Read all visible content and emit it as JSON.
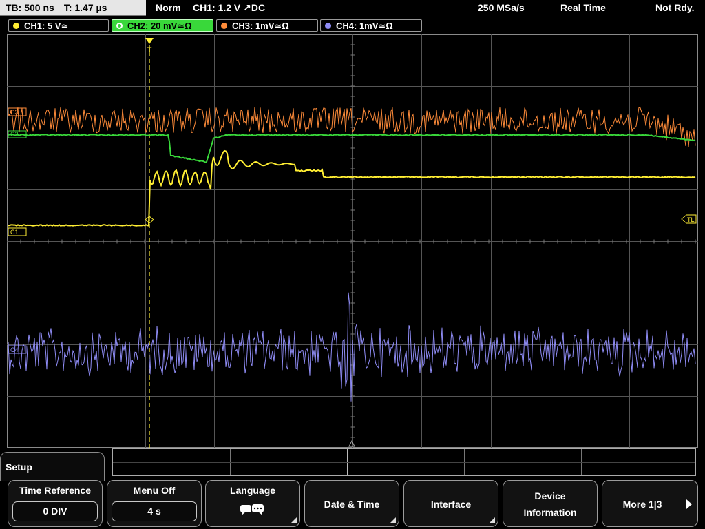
{
  "status": {
    "timebase": "TB: 500 ns",
    "trigger_time": "T: 1.47 µs",
    "mode": "Norm",
    "trigger": "CH1: 1.2 V ↗DC",
    "sample_rate": "250 MSa/s",
    "acq_mode": "Real Time",
    "state": "Not Rdy."
  },
  "channels": [
    {
      "label": "CH1: 5 V≃",
      "color": "#ffee33"
    },
    {
      "label": "CH2: 20 mV≃Ω",
      "color": "#39d83a"
    },
    {
      "label": "CH3: 1mV≃Ω",
      "color": "#ff8c3a"
    },
    {
      "label": "CH4: 1mV≃Ω",
      "color": "#8f8cf5"
    }
  ],
  "markers": {
    "ch3": "C3",
    "ch2": "C2",
    "ch1": "C1",
    "ch4": "C4",
    "trigger_level": "TL",
    "trigger": "T"
  },
  "menu": {
    "title": "Setup",
    "softkeys": [
      {
        "label": "Time Reference",
        "value": "0 DIV"
      },
      {
        "label": "Menu Off",
        "value": "4 s"
      },
      {
        "label": "Language",
        "icon": "speech-bubbles-icon"
      },
      {
        "label": "Date & Time"
      },
      {
        "label": "Interface"
      },
      {
        "label": "Device",
        "label2": "Information"
      },
      {
        "label": "More 1|3"
      }
    ]
  }
}
